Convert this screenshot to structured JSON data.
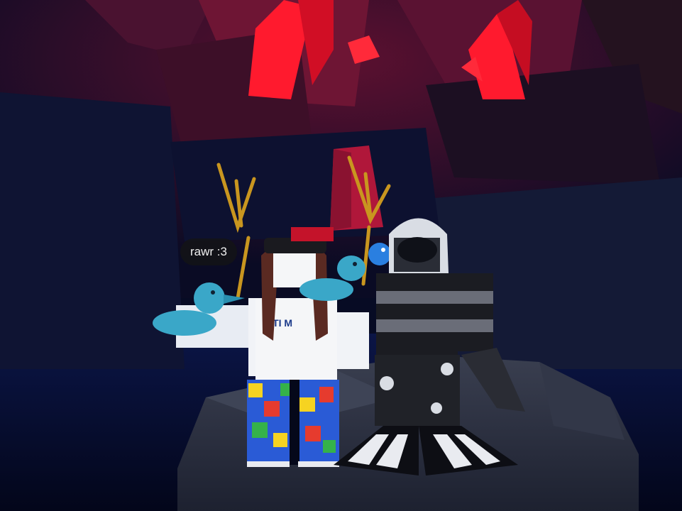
{
  "chat": {
    "message": "rawr :3"
  },
  "colors": {
    "sky": "#070b24",
    "cave_red": "#b0173a",
    "crystal_red": "#ff1a2e",
    "rock": "#2a2f3e",
    "duck_blue": "#3aa7c8",
    "pitchfork_gold": "#c9961f"
  }
}
